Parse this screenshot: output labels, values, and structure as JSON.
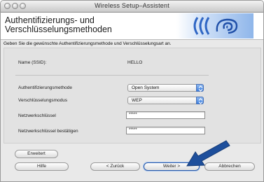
{
  "window": {
    "title": "Wireless Setup–Assistent"
  },
  "header": {
    "title_line1": "Authentifizierungs- und",
    "title_line2": "Verschlüsselungsmethoden",
    "logo_text": "((( (ϕ)"
  },
  "instruction": "Geben Sie die gewünschte Authentifizierungsmethode und Verschlüsselungsart an.",
  "form": {
    "ssid_label": "Name (SSID):",
    "ssid_value": "HELLO",
    "auth_label": "Authentifizierungsmethode",
    "auth_value": "Open System",
    "encryption_label": "Verschlüsselungsmodus",
    "encryption_value": "WEP",
    "key_label": "Netzwerkschlüssel",
    "key_value": "*****",
    "confirm_label": "Netzwerkschlüssel bestätigen",
    "confirm_value": "*****"
  },
  "buttons": {
    "advanced": "Erweitert",
    "help": "Hilfe",
    "back": "< Zurück",
    "next": "Weiter >",
    "cancel": "Abbrechen"
  },
  "colors": {
    "accent": "#1f5bb5",
    "arrow": "#1e4f9c"
  },
  "icons": {
    "wifi": "wifi-logo-icon",
    "arrow": "pointer-arrow-icon"
  }
}
